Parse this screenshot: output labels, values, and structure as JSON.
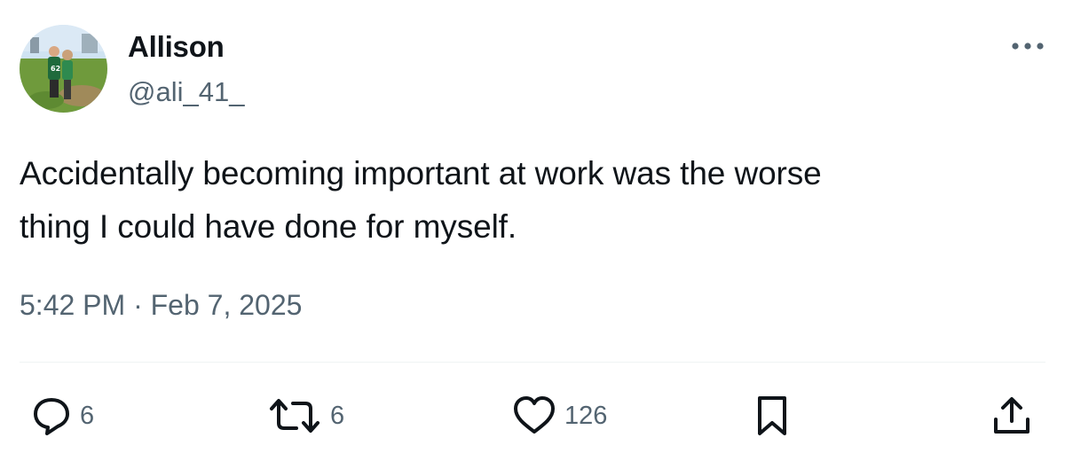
{
  "author": {
    "display_name": "Allison",
    "handle": "@ali_41_"
  },
  "icons": {
    "avatar": "profile-photo",
    "more": "more-dots-icon",
    "reply": "reply-icon",
    "retweet": "retweet-icon",
    "like": "heart-icon",
    "bookmark": "bookmark-icon",
    "share": "share-icon"
  },
  "tweet": {
    "text_line1": "Accidentally becoming important at work was the worse",
    "text_line2": "thing I could have done for myself.",
    "timestamp": "5:42 PM · Feb 7, 2025"
  },
  "actions": {
    "reply_count": "6",
    "retweet_count": "6",
    "like_count": "126"
  },
  "colors": {
    "text": "#0f1419",
    "secondary": "#536471",
    "divider": "#eff3f4"
  }
}
